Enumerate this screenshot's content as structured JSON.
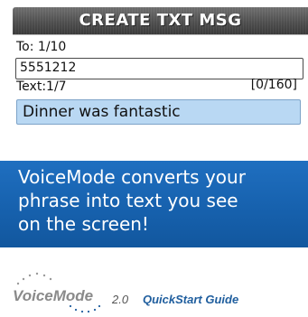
{
  "screen": {
    "title": "CREATE TXT MSG",
    "to_label": "To: 1/10",
    "number_value": "5551212",
    "text_label": "Text:1/7",
    "char_count": "[0/160]",
    "message_value": "Dinner was fantastic"
  },
  "callout": {
    "line1": "VoiceMode converts your",
    "line2": "phrase into text you see",
    "line3": "on the screen!",
    "color": "#1966b5"
  },
  "footer": {
    "logo_text": "VoiceMode",
    "version": "2.0",
    "guide_label": "QuickStart Guide"
  }
}
